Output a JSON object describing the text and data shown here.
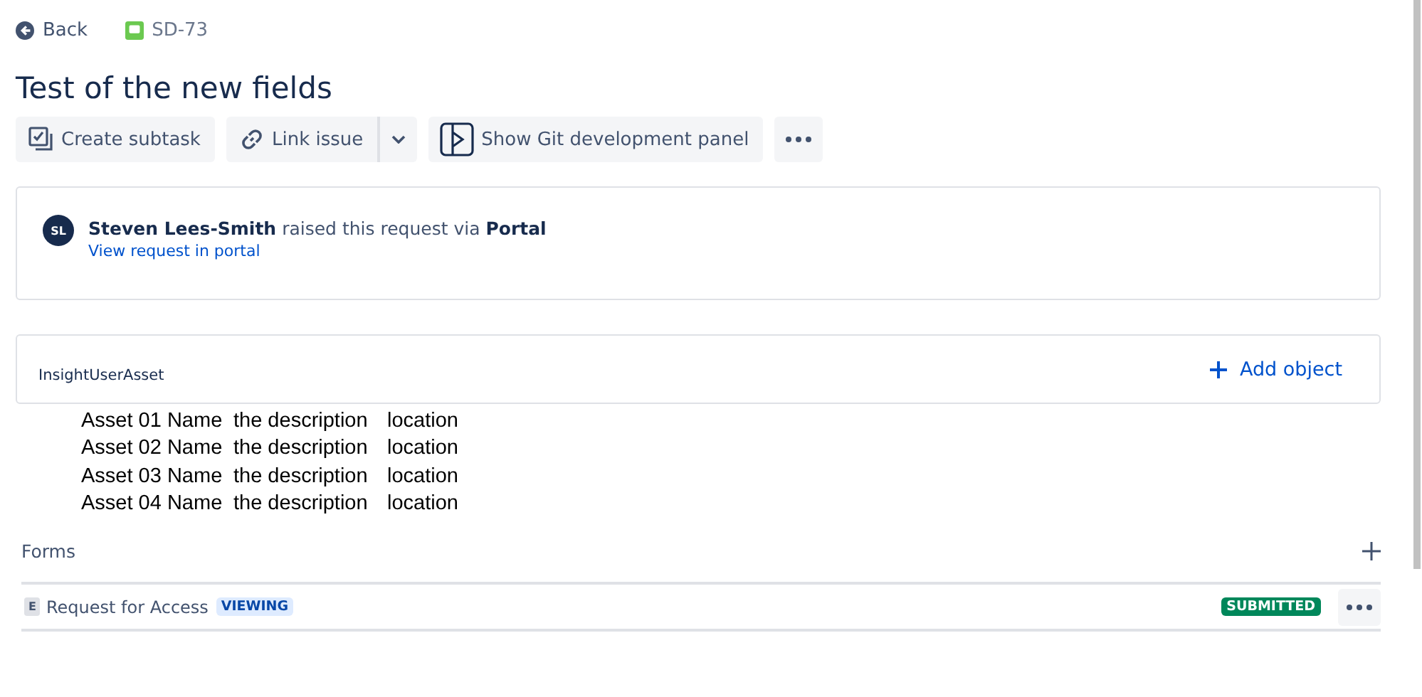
{
  "breadcrumb": {
    "back": "Back",
    "issue_key": "SD-73"
  },
  "title": "Test of the new fields",
  "toolbar": {
    "create_subtask": "Create subtask",
    "link_issue": "Link issue",
    "git_panel": "Show Git development panel"
  },
  "request": {
    "avatar_initials": "SL",
    "reporter": "Steven Lees-Smith",
    "middle": "raised this request via",
    "channel": "Portal",
    "link": "View request in portal"
  },
  "asset_field": {
    "label": "InsightUserAsset",
    "add": "Add object"
  },
  "assets": [
    {
      "name": "Asset 01 Name",
      "description": "the description",
      "location": "location"
    },
    {
      "name": "Asset 02 Name",
      "description": "the description",
      "location": "location"
    },
    {
      "name": "Asset 03 Name",
      "description": "the description",
      "location": "location"
    },
    {
      "name": "Asset 04 Name",
      "description": "the description",
      "location": "location"
    }
  ],
  "forms": {
    "title": "Forms",
    "items": [
      {
        "letter": "E",
        "name": "Request for Access",
        "tag": "VIEWING",
        "status": "SUBMITTED"
      }
    ]
  }
}
